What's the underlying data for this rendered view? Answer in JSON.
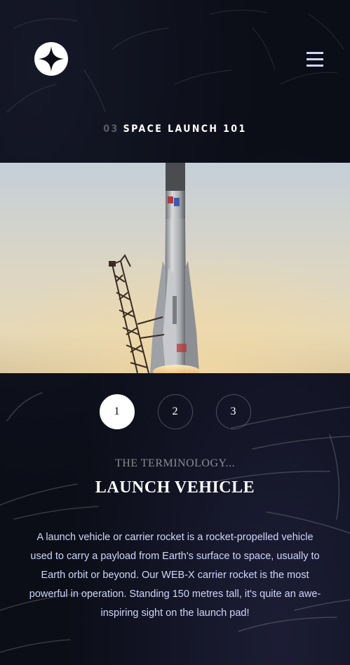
{
  "header": {
    "logo_icon": "star-logo-icon",
    "menu_icon": "hamburger-menu-icon"
  },
  "page": {
    "number": "03",
    "title": "SPACE LAUNCH 101"
  },
  "hero": {
    "image_subject": "launch vehicle on launch pad"
  },
  "steps": [
    {
      "label": "1",
      "active": true
    },
    {
      "label": "2",
      "active": false
    },
    {
      "label": "3",
      "active": false
    }
  ],
  "content": {
    "eyebrow": "THE TERMINOLOGY...",
    "title": "LAUNCH VEHICLE",
    "description": "A launch vehicle or carrier rocket is a rocket-propelled vehicle used to carry a payload from Earth's surface to space, usually to Earth orbit or beyond. Our WEB-X carrier rocket is the most powerful in operation. Standing 150 metres tall, it's quite an awe-inspiring sight on the launch pad!"
  },
  "colors": {
    "background": "#0b0d17",
    "accent": "#d0d6f9",
    "white": "#ffffff"
  }
}
